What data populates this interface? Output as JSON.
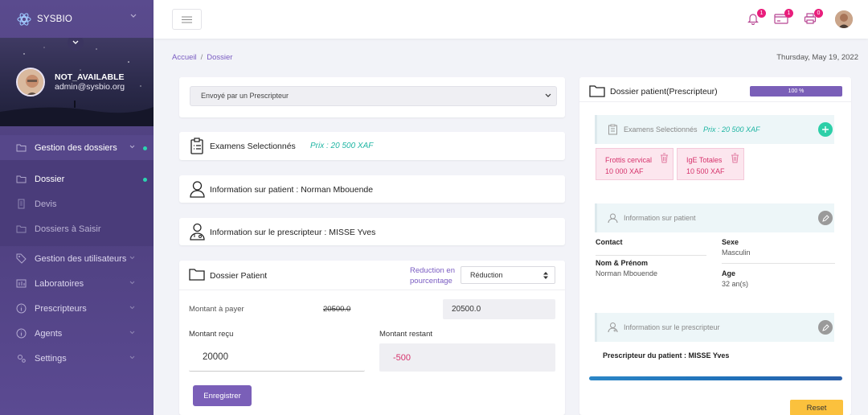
{
  "app": {
    "brand": "SYSBIO"
  },
  "user": {
    "name": "NOT_AVAILABLE",
    "email": "admin@sysbio.org"
  },
  "sidebar": {
    "section_title": "Gestion des dossiers",
    "sub_items": [
      "Dossier",
      "Devis",
      "Dossiers à Saisir"
    ],
    "items": [
      "Gestion des utilisateurs",
      "Laboratoires",
      "Prescripteurs",
      "Agents",
      "Settings"
    ]
  },
  "topbar": {
    "notifications": "1",
    "messages": "1",
    "print_count": "0"
  },
  "breadcrumb": {
    "home": "Accueil",
    "current": "Dossier"
  },
  "date": "Thursday, May 19, 2022",
  "form": {
    "sender_select": "Envoyé par un Prescripteur",
    "exams_title": "Examens Selectionnés",
    "exams_price": "Prix : 20 500 XAF",
    "patient_info": "Information sur patient : Norman Mbouende",
    "prescriber_info": "Information sur le prescripteur : MISSE Yves",
    "dossier_title": "Dossier Patient",
    "reduction_label": "Reduction en pourcentage",
    "reduction_select": "Réduction",
    "amount_due_label": "Montant à payer",
    "amount_due_struck": "20500.0",
    "amount_due_value": "20500.0",
    "amount_received_label": "Montant reçu",
    "amount_received_value": "20000",
    "amount_remaining_label": "Montant restant",
    "amount_remaining_value": "-500",
    "save_button": "Enregistrer"
  },
  "summary": {
    "title": "Dossier patient(Prescripteur)",
    "progress": "100 %",
    "progress_value": 100,
    "exams_label": "Examens Selectionnés",
    "exams_price": "Prix : 20 500 XAF",
    "exams": [
      {
        "name": "Frottis cervical",
        "price": "10 000 XAF"
      },
      {
        "name": "IgE Totales",
        "price": "10 500 XAF"
      }
    ],
    "patient_label": "Information sur patient",
    "contact_label": "Contact",
    "sexe_label": "Sexe",
    "sexe_value": "Masculin",
    "name_label": "Nom & Prénom",
    "name_value": "Norman Mbouende",
    "age_label": "Age",
    "age_value": "32 an(s)",
    "prescriber_label": "Information sur le prescripteur",
    "prescriber_value": "Prescripteur du patient : MISSE Yves",
    "reset_button": "Reset"
  },
  "colors": {
    "accent": "#7a5fb8",
    "teal": "#1fb5a3",
    "pink": "#d6336c",
    "warn": "#fbc13d"
  }
}
